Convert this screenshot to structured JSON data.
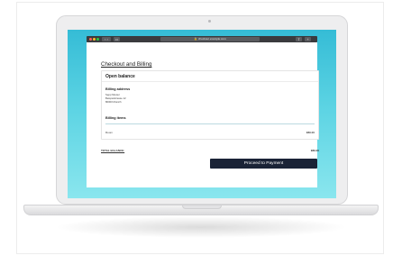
{
  "browser": {
    "address": "checkout.example.com",
    "back_label": "‹ ›",
    "tabs_label": "▭",
    "share_label": "⇪",
    "newtab_label": "+"
  },
  "icons": {
    "lock": "lock-icon"
  },
  "page": {
    "title": "Checkout and Billing",
    "card_title": "Open balance",
    "billing_address_title": "Billing address",
    "address_lines": [
      "Sepp Muster",
      "Beispielstrasse 12",
      "80000 Munich"
    ],
    "billing_items_title": "Billing items",
    "items": [
      {
        "name": "Room",
        "price": "€89.00"
      }
    ],
    "total_label": "TOTAL BALANCE:",
    "total_value": "€89.00",
    "pay_button": "Proceed to Payment"
  },
  "colors": {
    "screen_gradient_top": "#35bcd6",
    "screen_gradient_bottom": "#8ae6ee",
    "button_bg": "#1a2336"
  }
}
